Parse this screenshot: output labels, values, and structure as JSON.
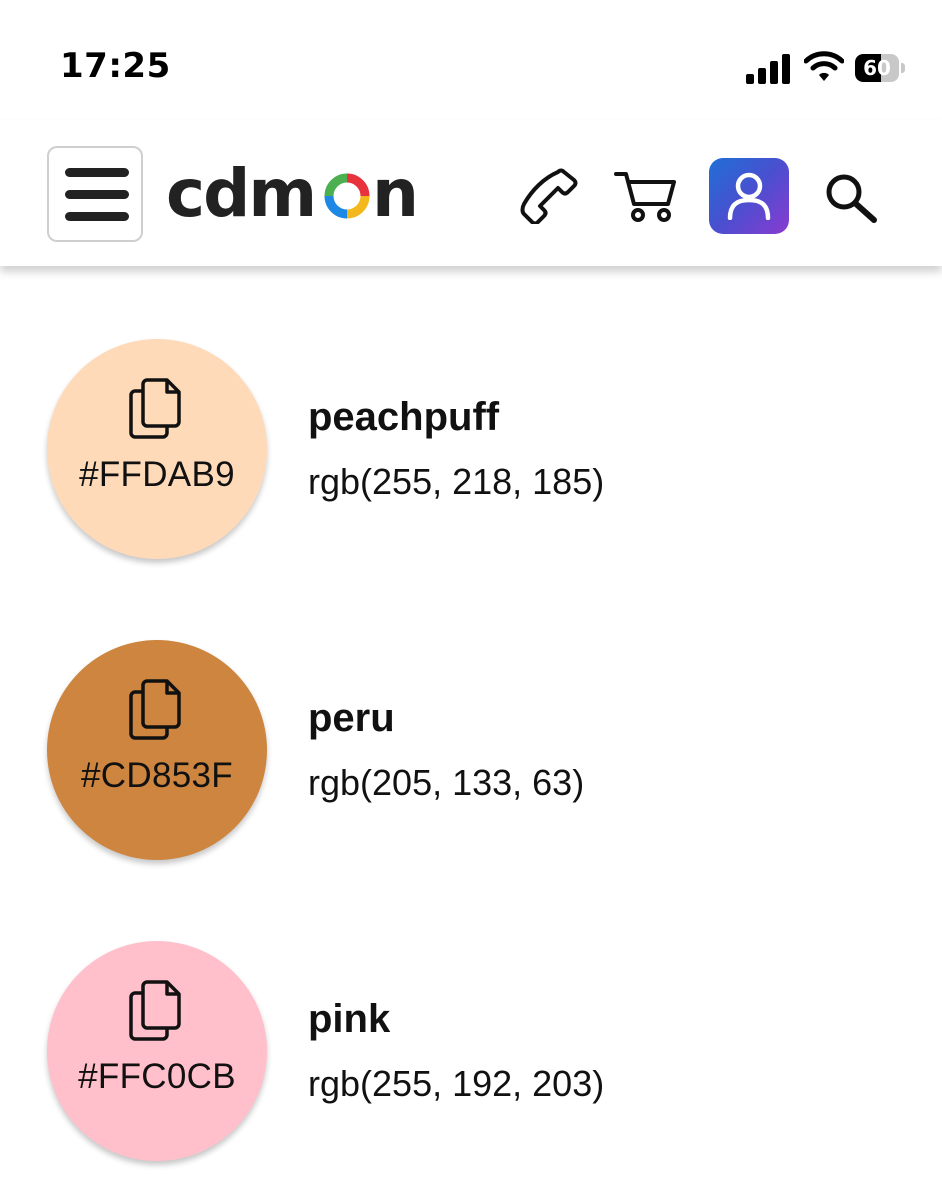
{
  "status_bar": {
    "time": "17:25",
    "battery_level": "60",
    "battery_fraction": 0.6
  },
  "header": {
    "menu_icon": "hamburger-menu-icon",
    "logo_text": "cdmon",
    "logo_parts": {
      "before": "cdm",
      "ring": "o",
      "after": "n"
    },
    "icons": [
      "phone-icon",
      "cart-icon",
      "user-icon",
      "search-icon"
    ],
    "accent_gradient": [
      "#1f6fd6",
      "#8a3bd0"
    ]
  },
  "colors": [
    {
      "name": "peachpuff",
      "hex": "#FFDAB9",
      "rgb": "rgb(255, 218, 185)"
    },
    {
      "name": "peru",
      "hex": "#CD853F",
      "rgb": "rgb(205, 133, 63)"
    },
    {
      "name": "pink",
      "hex": "#FFC0CB",
      "rgb": "rgb(255, 192, 203)"
    }
  ]
}
